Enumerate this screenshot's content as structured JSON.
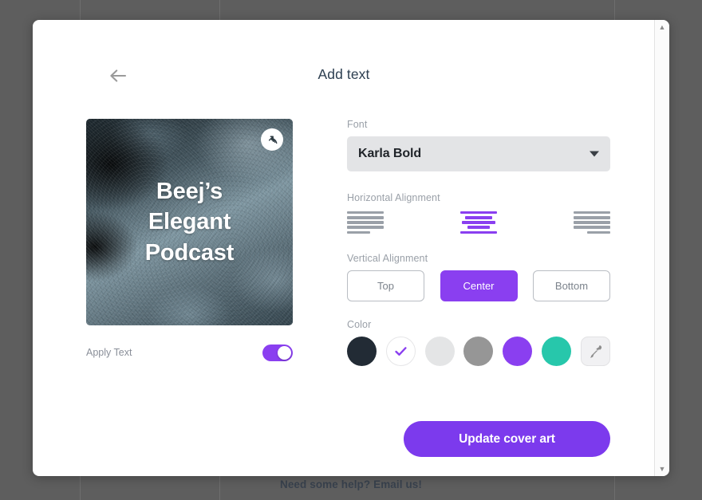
{
  "background": {
    "help_text": "Need some help? Email us!"
  },
  "modal": {
    "title": "Add text",
    "back_icon": "arrow-left-icon",
    "scrollbar": {
      "up_arrow": "▲",
      "down_arrow": "▼"
    }
  },
  "cover": {
    "title_lines": [
      "Beej’s",
      "Elegant",
      "Podcast"
    ],
    "badge_icon": "podcast-broadcast-icon"
  },
  "apply_text": {
    "label": "Apply Text",
    "enabled": true
  },
  "font": {
    "label": "Font",
    "selected": "Karla Bold",
    "caret_icon": "chevron-down-icon"
  },
  "horizontal_alignment": {
    "label": "Horizontal Alignment",
    "options": [
      {
        "value": "left",
        "icon": "align-left-icon",
        "selected": false
      },
      {
        "value": "center",
        "icon": "align-center-icon",
        "selected": true
      },
      {
        "value": "right",
        "icon": "align-right-icon",
        "selected": false
      }
    ]
  },
  "vertical_alignment": {
    "label": "Vertical Alignment",
    "options": [
      {
        "label": "Top",
        "selected": false
      },
      {
        "label": "Center",
        "selected": true
      },
      {
        "label": "Bottom",
        "selected": false
      }
    ]
  },
  "color": {
    "label": "Color",
    "swatches": [
      {
        "hex": "#222b35",
        "selected": false
      },
      {
        "hex": "#ffffff",
        "selected": true
      },
      {
        "hex": "#e4e5e6",
        "selected": false
      },
      {
        "hex": "#969696",
        "selected": false
      },
      {
        "hex": "#8a3ff0",
        "selected": false
      },
      {
        "hex": "#27c7ab",
        "selected": false
      }
    ],
    "eyedropper_icon": "eyedropper-icon",
    "check_icon": "check-icon",
    "check_color": "#8a3ff0"
  },
  "cta": {
    "label": "Update cover art",
    "color": "#7c3aed"
  },
  "theme": {
    "accent": "#8a3ff0",
    "title_color": "#2c3e50",
    "label_color": "#9aa0a8",
    "overlay": "#5e5e5e"
  }
}
